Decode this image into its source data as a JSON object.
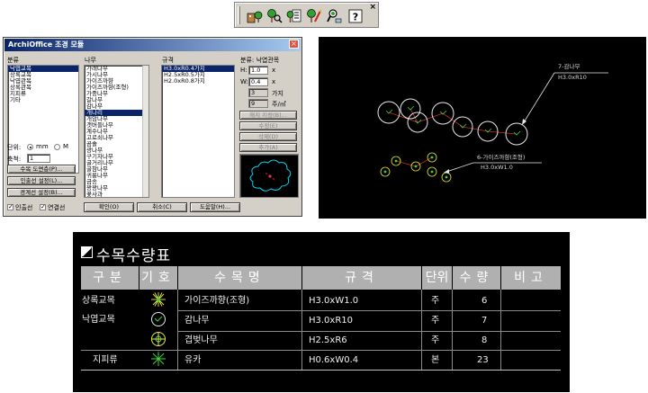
{
  "toolbar": {
    "buttons": [
      {
        "icon": "building-tree-icon"
      },
      {
        "icon": "tree-search-icon"
      },
      {
        "icon": "tree-list-icon"
      },
      {
        "icon": "tree-paint-icon"
      },
      {
        "icon": "tree-magnify-icon"
      },
      {
        "icon": "help-icon",
        "glyph": "?"
      }
    ],
    "close_glyph": "×"
  },
  "dialog": {
    "title": "ArchiOffice 조경 모듈",
    "close_glyph": "×",
    "category_label": "분류",
    "category_items": [
      "낙엽교목",
      "상록교목",
      "낙엽관목",
      "상록관목",
      "지피류",
      "기타"
    ],
    "category_selected": 0,
    "tree_label": "나무",
    "tree_items": [
      "가래나무",
      "가시나무",
      "가이즈까향",
      "가이즈까향(조형)",
      "가중나무",
      "갈나무",
      "감나무",
      "개나리",
      "개암나무",
      "갯버들나무",
      "계수나무",
      "고로쇠나무",
      "곰솔",
      "광나무",
      "구기자나무",
      "굴거리나무",
      "굴참나무",
      "귀룽나무",
      "금송",
      "꽝꽝나무",
      "꽃사과",
      "낙상홍"
    ],
    "tree_selected": 7,
    "spec_label": "규격",
    "spec_items": [
      "H3.0xR0.4가지",
      "H2.5xR0.5가지",
      "H2.0xR0.8가지"
    ],
    "spec_selected": 0,
    "props_label": "분류: 낙엽관목",
    "h_label": "H:",
    "h_value": "1.0",
    "w_label": "W:",
    "w_value": "0.4",
    "count_value": "3",
    "count_unit": "가지",
    "density_value": "9",
    "density_unit": "주/㎡",
    "unit_x": "x",
    "btn_spec_save": "해치 지정(B)...",
    "btn_modify": "수정(E)",
    "btn_delete": "삭제(D)",
    "btn_add": "추가(A)",
    "unit_label": "단위:",
    "unit_mm": "mm",
    "unit_m": "M",
    "scale_label": "축척:",
    "scale_value": "1",
    "btn_table": "수목 도면층(P)...",
    "btn_leader": "인출선 설정(L)...",
    "btn_boundary": "경계선 설정(B)...",
    "chk_leader": "인출선",
    "chk_boundary": "연결선",
    "btn_ok": "확인(O)",
    "btn_cancel": "취소(C)",
    "btn_help": "도움말(H)..."
  },
  "cad": {
    "label1_name": "7-감나무",
    "label1_spec": "H3.0xR10",
    "label2_name": "6-가이즈까향(조형)",
    "label2_spec": "H3.0xW1.0"
  },
  "table": {
    "title": "수목수량표",
    "headers": [
      "구분",
      "기호",
      "수목명",
      "규격",
      "단위",
      "수량",
      "비고"
    ],
    "rows": [
      {
        "category": "상록교목",
        "symbol": "star-burst-icon",
        "name": "가이즈까향(조형)",
        "spec": "H3.0xW1.0",
        "unit": "주",
        "qty": "6",
        "note": ""
      },
      {
        "category": "낙엽교목",
        "symbol": "circle-tick-icon",
        "name": "감나무",
        "spec": "H3.0xR10",
        "unit": "주",
        "qty": "7",
        "note": ""
      },
      {
        "category": "",
        "symbol": "cross-circle-icon",
        "name": "겹벚나무",
        "spec": "H2.5xR6",
        "unit": "주",
        "qty": "8",
        "note": ""
      },
      {
        "category": "지피류",
        "symbol": "asterisk-icon",
        "name": "유카",
        "spec": "H0.6xW0.4",
        "unit": "본",
        "qty": "23",
        "note": ""
      }
    ]
  },
  "colors": {
    "cad_background": "#000000",
    "highlight": "#0a246a",
    "symbol_yellow": "#e8e840",
    "symbol_green": "#40d040",
    "leader_red": "#d04040"
  }
}
